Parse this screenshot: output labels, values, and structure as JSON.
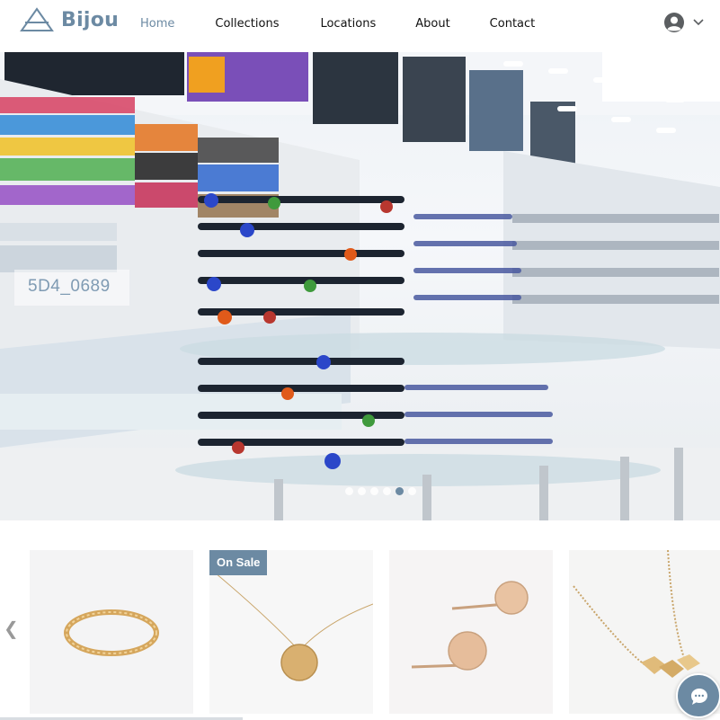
{
  "brand": {
    "name": "Bijou",
    "logo_icon": "triangle-logo-icon",
    "accent": "#6c8aa3"
  },
  "nav": {
    "items": [
      {
        "label": "Home",
        "active": true
      },
      {
        "label": "Collections",
        "active": false
      },
      {
        "label": "Locations",
        "active": false
      },
      {
        "label": "About",
        "active": false
      },
      {
        "label": "Contact",
        "active": false
      }
    ]
  },
  "account": {
    "icon": "user-avatar-icon",
    "menu_icon": "chevron-down-icon"
  },
  "hero": {
    "caption": "5D4_0689",
    "image_alt": "Sunglasses display in a store",
    "slide_count": 6,
    "active_slide": 5
  },
  "products": {
    "prev_icon": "chevron-left-icon",
    "cards": [
      {
        "name": "Twisted gold ring",
        "badge": ""
      },
      {
        "name": "Gold disc necklace",
        "badge": "On Sale"
      },
      {
        "name": "Rose gold disc stud earrings",
        "badge": ""
      },
      {
        "name": "Gold geometric cube necklace",
        "badge": ""
      }
    ]
  },
  "chat": {
    "icon": "chat-bubble-icon"
  }
}
